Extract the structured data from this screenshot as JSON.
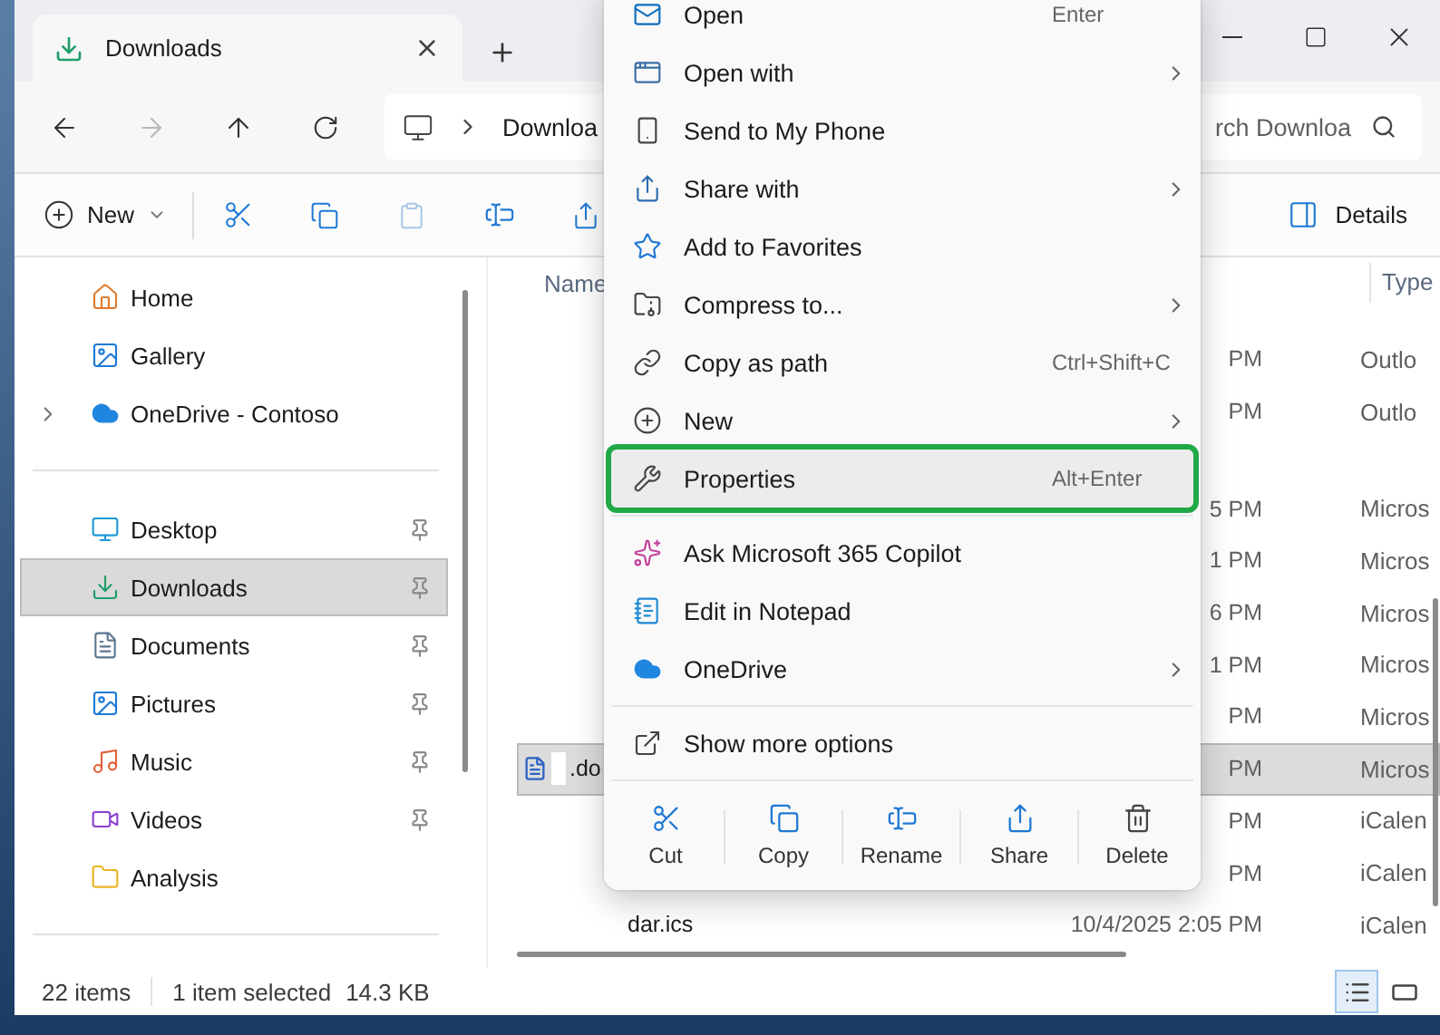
{
  "window": {
    "tab": {
      "title": "Downloads",
      "selected": true
    }
  },
  "address": {
    "crumb": "Downloa",
    "search_placeholder": "rch Downloa"
  },
  "toolbar": {
    "new_label": "New",
    "details_label": "Details",
    "paste_disabled": true,
    "forward_disabled": true
  },
  "sidebar": {
    "sections": [
      {
        "items": [
          {
            "label": "Home",
            "pinned": false,
            "selected": false,
            "expandable": false
          },
          {
            "label": "Gallery",
            "pinned": false,
            "selected": false,
            "expandable": false
          },
          {
            "label": "OneDrive - Contoso",
            "pinned": false,
            "selected": false,
            "expandable": true
          }
        ]
      },
      {
        "items": [
          {
            "label": "Desktop",
            "pinned": true,
            "selected": false,
            "expandable": false
          },
          {
            "label": "Downloads",
            "pinned": true,
            "selected": true,
            "expandable": false
          },
          {
            "label": "Documents",
            "pinned": true,
            "selected": false,
            "expandable": false
          },
          {
            "label": "Pictures",
            "pinned": true,
            "selected": false,
            "expandable": false
          },
          {
            "label": "Music",
            "pinned": true,
            "selected": false,
            "expandable": false
          },
          {
            "label": "Videos",
            "pinned": true,
            "selected": false,
            "expandable": false
          },
          {
            "label": "Analysis",
            "pinned": false,
            "selected": false,
            "expandable": false
          }
        ]
      }
    ]
  },
  "files": {
    "columns": [
      "Name",
      "Type"
    ],
    "groups": [
      {
        "rows": [
          {
            "kind": "plain",
            "name": "",
            "date": "PM",
            "type": "Outlo",
            "selected": false
          },
          {
            "kind": "plain",
            "name": "",
            "date": "PM",
            "type": "Outlo",
            "selected": false
          }
        ]
      },
      {
        "rows": [
          {
            "kind": "plain",
            "name": "",
            "date": "5 PM",
            "type": "Micros",
            "selected": false
          },
          {
            "kind": "plain",
            "name": "",
            "date": "1 PM",
            "type": "Micros",
            "selected": false
          },
          {
            "kind": "plain",
            "name": "",
            "date": "6 PM",
            "type": "Micros",
            "selected": false
          },
          {
            "kind": "plain",
            "name": "",
            "date": "1 PM",
            "type": "Micros",
            "selected": false
          },
          {
            "kind": "plain",
            "name": "",
            "date": "PM",
            "type": "Micros",
            "selected": false
          },
          {
            "kind": "doc",
            "name": ".do",
            "date": "PM",
            "type": "Micros",
            "selected": true
          },
          {
            "kind": "plain",
            "name": "",
            "date": "PM",
            "type": "iCalen",
            "selected": false
          },
          {
            "kind": "plain",
            "name": "",
            "date": "PM",
            "type": "iCalen",
            "selected": false
          },
          {
            "kind": "plain",
            "name": "dar.ics",
            "date": "10/4/2025 2:05 PM",
            "type": "iCalen",
            "selected": false
          }
        ]
      }
    ]
  },
  "context_menu": {
    "sections": [
      {
        "items": [
          {
            "label": "Open",
            "shortcut": "Enter",
            "submenu": false,
            "highlighted": false
          },
          {
            "label": "Open with",
            "submenu": true,
            "highlighted": false
          },
          {
            "label": "Send to My Phone",
            "submenu": false,
            "highlighted": false
          },
          {
            "label": "Share with",
            "submenu": true,
            "highlighted": false
          },
          {
            "label": "Add to Favorites",
            "submenu": false,
            "highlighted": false
          },
          {
            "label": "Compress to...",
            "submenu": true,
            "highlighted": false
          },
          {
            "label": "Copy as path",
            "shortcut": "Ctrl+Shift+C",
            "submenu": false,
            "highlighted": false
          },
          {
            "label": "New",
            "submenu": true,
            "highlighted": false
          },
          {
            "label": "Properties",
            "shortcut": "Alt+Enter",
            "submenu": false,
            "highlighted": true
          }
        ]
      },
      {
        "items": [
          {
            "label": "Ask Microsoft 365 Copilot",
            "submenu": false,
            "highlighted": false
          },
          {
            "label": "Edit in Notepad",
            "submenu": false,
            "highlighted": false
          },
          {
            "label": "OneDrive",
            "submenu": true,
            "highlighted": false
          }
        ]
      },
      {
        "items": [
          {
            "label": "Show more options",
            "submenu": false,
            "highlighted": false
          }
        ]
      }
    ],
    "actions": [
      "Cut",
      "Copy",
      "Rename",
      "Share",
      "Delete"
    ]
  },
  "status_bar": {
    "count": "22 items",
    "selection": "1 item selected",
    "size": "14.3 KB",
    "views": [
      {
        "selected": true
      },
      {
        "selected": false
      }
    ]
  }
}
